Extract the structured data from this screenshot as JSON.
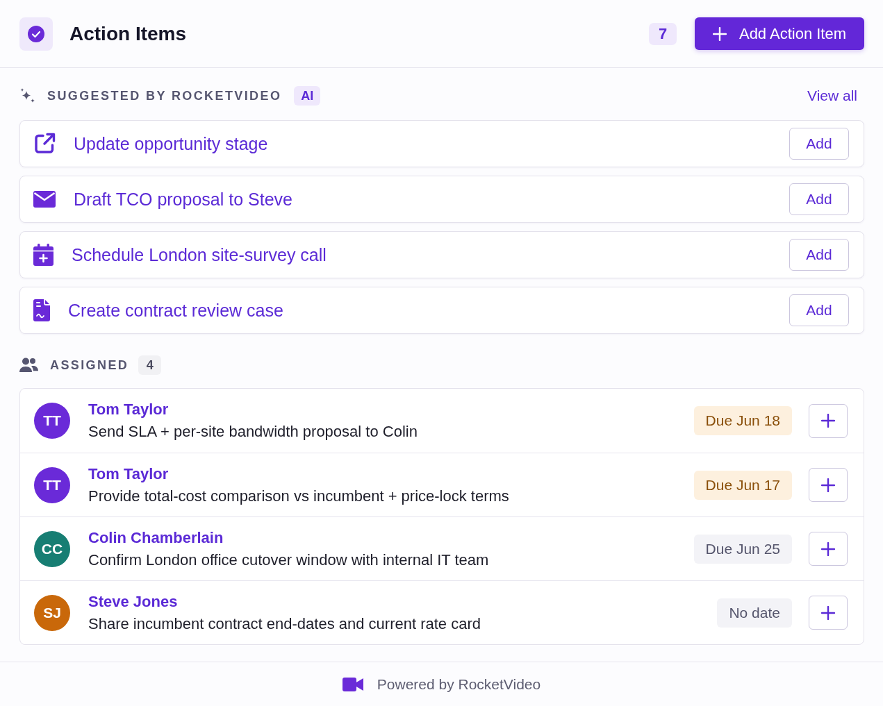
{
  "header": {
    "title": "Action Items",
    "count": "7",
    "add_button": "Add Action Item"
  },
  "suggested": {
    "heading": "SUGGESTED BY ROCKETVIDEO",
    "badge": "AI",
    "link": "View all",
    "items": [
      {
        "kind": "link",
        "label": "Update opportunity stage",
        "action": "Add"
      },
      {
        "kind": "email",
        "label": "Draft TCO proposal to Steve",
        "action": "Add"
      },
      {
        "kind": "calendar",
        "label": "Schedule London site-survey call",
        "action": "Add"
      },
      {
        "kind": "document",
        "label": "Create contract review case",
        "action": "Add"
      }
    ]
  },
  "assigned": {
    "heading": "ASSIGNED",
    "count": "4",
    "items": [
      {
        "initials": "TT",
        "color": "#6a2ad8",
        "name": "Tom Taylor",
        "task": "Send SLA + per-site bandwidth proposal to Colin",
        "due": {
          "label": "Due Jun 18",
          "color": "#fdf0de"
        }
      },
      {
        "initials": "TT",
        "color": "#6a2ad8",
        "name": "Tom Taylor",
        "task": "Provide total-cost comparison vs incumbent + price-lock terms",
        "due": {
          "label": "Due Jun 17",
          "color": "#fdf0de"
        }
      },
      {
        "initials": "CC",
        "color": "#177e73",
        "name": "Colin Chamberlain",
        "task": "Confirm London office cutover window with internal IT team",
        "due": {
          "label": "Due Jun 25",
          "color": "#f3f3f7"
        }
      },
      {
        "initials": "SJ",
        "color": "#c9680a",
        "name": "Steve Jones",
        "task": "Share incumbent contract end-dates and current rate card",
        "due": {
          "label": "No date",
          "color": "#f3f3f7"
        }
      }
    ]
  },
  "footer": {
    "text": "Powered by RocketVideo"
  }
}
